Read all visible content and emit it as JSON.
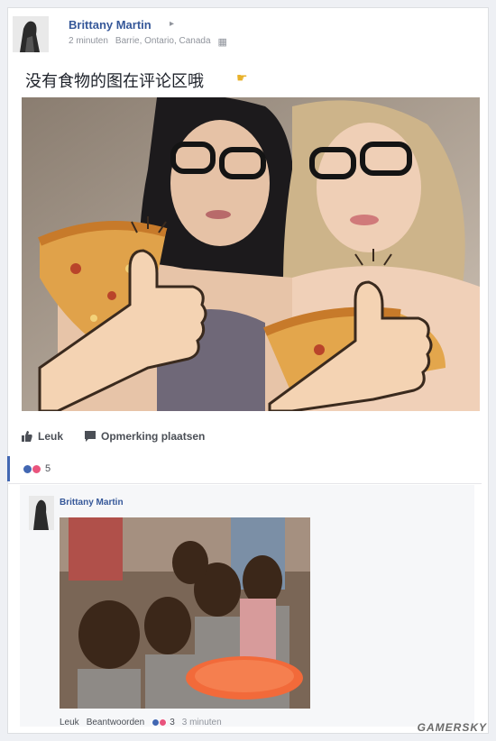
{
  "post": {
    "author": "Brittany Martin",
    "time": "2 minuten",
    "location": "Barrie, Ontario, Canada",
    "text": "没有食物的图在评论区哦",
    "hand_icon": "pointing-hand-icon",
    "photo_icon": "selfie-photo"
  },
  "actions": {
    "like_label": "Leuk",
    "comment_label": "Opmerking plaatsen"
  },
  "reactions": {
    "count": "5",
    "colors": [
      "#4267b2",
      "#e9547d"
    ]
  },
  "comment": {
    "author": "Brittany Martin",
    "like_label": "Leuk",
    "reply_label": "Beantwoorden",
    "reaction_count": "3",
    "time": "3 minuten"
  },
  "watermark": "GAMERSKY",
  "colors": {
    "link": "#365899",
    "meta": "#90949c",
    "accent": "#4267b2",
    "plate": "#f26a3a"
  }
}
